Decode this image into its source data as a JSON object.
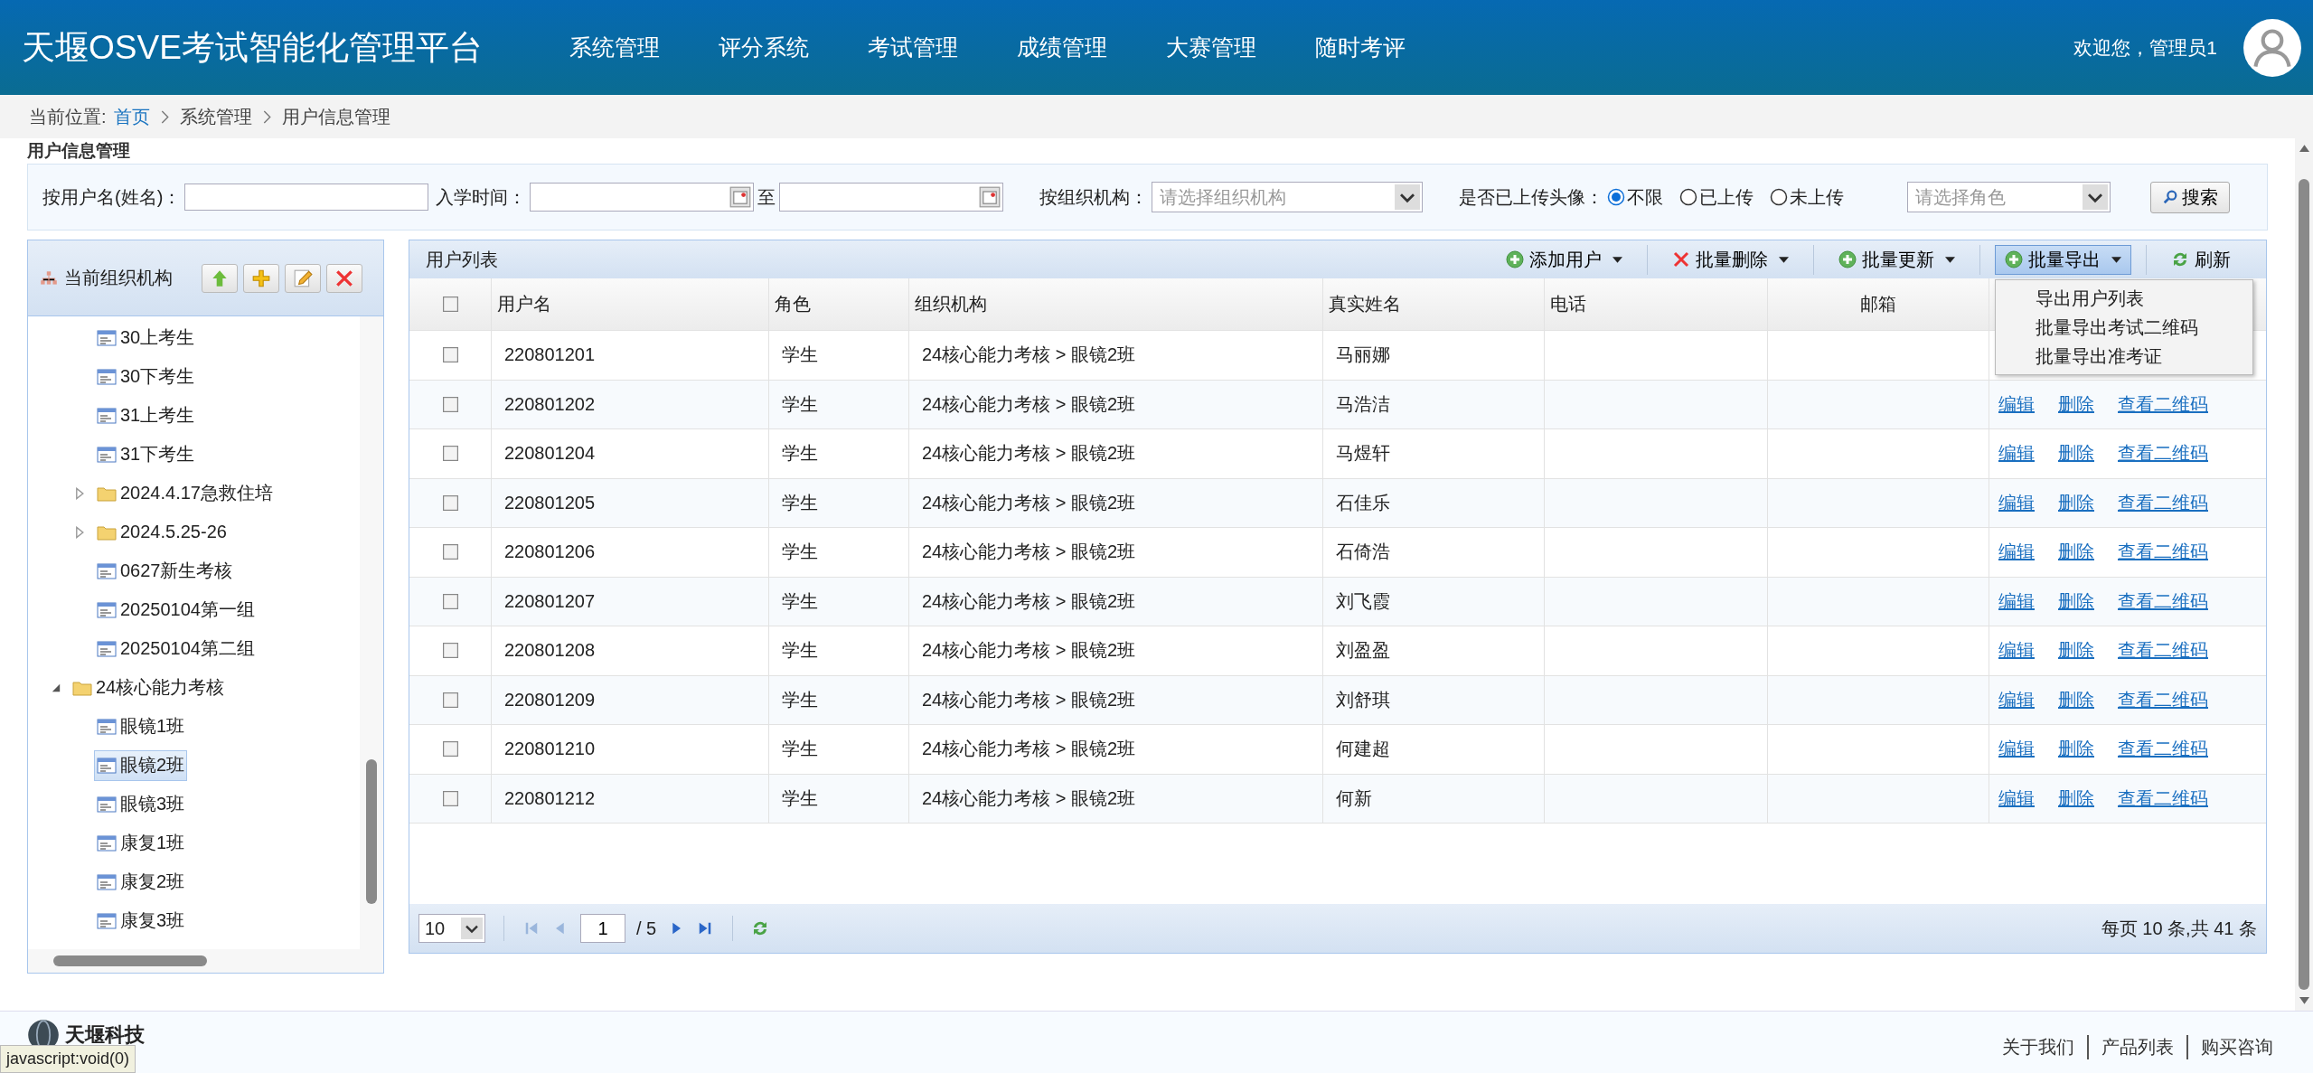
{
  "header": {
    "title": "天堰OSVE考试智能化管理平台",
    "nav": [
      {
        "label": "系统管理"
      },
      {
        "label": "评分系统"
      },
      {
        "label": "考试管理"
      },
      {
        "label": "成绩管理"
      },
      {
        "label": "大赛管理"
      },
      {
        "label": "随时考评"
      }
    ],
    "welcome": "欢迎您，管理员1"
  },
  "breadcrumb": {
    "label": "当前位置:",
    "items": [
      "首页",
      "系统管理",
      "用户信息管理"
    ]
  },
  "page_heading": "用户信息管理",
  "search": {
    "username_label": "按用户名(姓名)：",
    "enroll_label": "入学时间：",
    "to_label": "至",
    "org_label": "按组织机构：",
    "org_placeholder": "请选择组织机构",
    "avatar_label": "是否已上传头像：",
    "avatar_options": [
      {
        "label": "不限",
        "selected": true
      },
      {
        "label": "已上传",
        "selected": false
      },
      {
        "label": "未上传",
        "selected": false
      }
    ],
    "role_placeholder": "请选择角色",
    "search_button": "搜索"
  },
  "org_panel": {
    "title": "当前组织机构",
    "tree": [
      {
        "kind": "hidden",
        "children": [
          {
            "kind": "leaf",
            "label": "30上考生",
            "selected": false
          },
          {
            "kind": "leaf",
            "label": "30下考生",
            "selected": false
          },
          {
            "kind": "leaf",
            "label": "31上考生",
            "selected": false
          },
          {
            "kind": "leaf",
            "label": "31下考生",
            "selected": false
          },
          {
            "kind": "folder",
            "label": "2024.4.17急救住培",
            "expanded": false,
            "selected": false
          },
          {
            "kind": "folder",
            "label": "2024.5.25-26",
            "expanded": false,
            "selected": false
          },
          {
            "kind": "leaf",
            "label": "0627新生考核",
            "selected": false
          },
          {
            "kind": "leaf",
            "label": "20250104第一组",
            "selected": false
          },
          {
            "kind": "leaf",
            "label": "20250104第二组",
            "selected": false
          }
        ]
      },
      {
        "kind": "folder",
        "label": "24核心能力考核",
        "expanded": true,
        "selected": false,
        "children": [
          {
            "kind": "leaf",
            "label": "眼镜1班",
            "selected": false
          },
          {
            "kind": "leaf",
            "label": "眼镜2班",
            "selected": true
          },
          {
            "kind": "leaf",
            "label": "眼镜3班",
            "selected": false
          },
          {
            "kind": "leaf",
            "label": "康复1班",
            "selected": false
          },
          {
            "kind": "leaf",
            "label": "康复2班",
            "selected": false
          },
          {
            "kind": "leaf",
            "label": "康复3班",
            "selected": false
          }
        ]
      }
    ]
  },
  "user_table": {
    "title": "用户列表",
    "toolbar": [
      {
        "kind": "menu",
        "label": "添加用户",
        "open": false
      },
      {
        "kind": "menu",
        "label": "批量删除",
        "open": false
      },
      {
        "kind": "menu",
        "label": "批量更新",
        "open": false
      },
      {
        "kind": "menu",
        "label": "批量导出",
        "open": true,
        "menu": [
          "导出用户列表",
          "批量导出考试二维码",
          "批量导出准考证"
        ]
      },
      {
        "kind": "button",
        "label": "刷新"
      }
    ],
    "columns": [
      "用户名",
      "角色",
      "组织机构",
      "真实姓名",
      "电话",
      "邮箱"
    ],
    "header_checked": false,
    "rows": [
      {
        "checked": false,
        "username": "220801201",
        "role": "学生",
        "org": "24核心能力考核 > 眼镜2班",
        "name": "马丽娜"
      },
      {
        "checked": false,
        "username": "220801202",
        "role": "学生",
        "org": "24核心能力考核 > 眼镜2班",
        "name": "马浩洁",
        "actions": [
          "编辑",
          "删除",
          "查看二维码"
        ]
      },
      {
        "checked": false,
        "username": "220801204",
        "role": "学生",
        "org": "24核心能力考核 > 眼镜2班",
        "name": "马煜轩",
        "actions": [
          "编辑",
          "删除",
          "查看二维码"
        ]
      },
      {
        "checked": false,
        "username": "220801205",
        "role": "学生",
        "org": "24核心能力考核 > 眼镜2班",
        "name": "石佳乐",
        "actions": [
          "编辑",
          "删除",
          "查看二维码"
        ]
      },
      {
        "checked": false,
        "username": "220801206",
        "role": "学生",
        "org": "24核心能力考核 > 眼镜2班",
        "name": "石倚浩",
        "actions": [
          "编辑",
          "删除",
          "查看二维码"
        ]
      },
      {
        "checked": false,
        "username": "220801207",
        "role": "学生",
        "org": "24核心能力考核 > 眼镜2班",
        "name": "刘飞霞",
        "actions": [
          "编辑",
          "删除",
          "查看二维码"
        ]
      },
      {
        "checked": false,
        "username": "220801208",
        "role": "学生",
        "org": "24核心能力考核 > 眼镜2班",
        "name": "刘盈盈",
        "actions": [
          "编辑",
          "删除",
          "查看二维码"
        ]
      },
      {
        "checked": false,
        "username": "220801209",
        "role": "学生",
        "org": "24核心能力考核 > 眼镜2班",
        "name": "刘舒琪",
        "actions": [
          "编辑",
          "删除",
          "查看二维码"
        ]
      },
      {
        "checked": false,
        "username": "220801210",
        "role": "学生",
        "org": "24核心能力考核 > 眼镜2班",
        "name": "何建超",
        "actions": [
          "编辑",
          "删除",
          "查看二维码"
        ]
      },
      {
        "checked": false,
        "username": "220801212",
        "role": "学生",
        "org": "24核心能力考核 > 眼镜2班",
        "name": "何新",
        "actions": [
          "编辑",
          "删除",
          "查看二维码"
        ]
      }
    ],
    "pager": {
      "page_size": "10",
      "page": "1",
      "total_pages": "/ 5",
      "summary": "每页 10 条,共 41 条"
    }
  },
  "footer": {
    "brand": "天堰科技",
    "links": [
      "关于我们",
      "产品列表",
      "购买咨询"
    ]
  },
  "status_tooltip": "javascript:void(0)"
}
